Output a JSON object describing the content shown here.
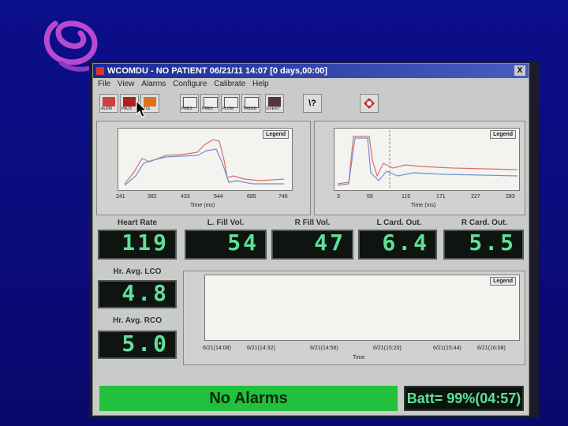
{
  "window": {
    "title": "WCOMDU - NO PATIENT 06/21/11 14:07 [0 days,00:00]",
    "close_label": "X"
  },
  "menu": [
    "File",
    "View",
    "Alarms",
    "Configure",
    "Calibrate",
    "Help"
  ],
  "toolbar": {
    "labels": [
      "ALRM",
      "PAUS",
      "FILE",
      "PRES",
      "PRES",
      "FLOW",
      "TREND",
      "EVENT"
    ],
    "help_label": "\\?"
  },
  "chart_left": {
    "legend": "Legend",
    "xlabel": "Time (ms)",
    "xticks": [
      "241",
      "382",
      "433",
      "544",
      "685",
      "746"
    ]
  },
  "chart_right": {
    "legend": "Legend",
    "xlabel": "Time (ms)",
    "xticks": [
      "3",
      "59",
      "115",
      "171",
      "227",
      "283"
    ]
  },
  "readouts": {
    "heart_rate": {
      "label": "Heart Rate",
      "value": "119"
    },
    "l_fill_vol": {
      "label": "L. Fill Vol.",
      "value": "54"
    },
    "r_fill_vol": {
      "label": "R Fill Vol.",
      "value": "47"
    },
    "l_card_out": {
      "label": "L Card. Out.",
      "value": "6.4"
    },
    "r_card_out": {
      "label": "R Card. Out.",
      "value": "5.5"
    },
    "hr_avg_lco": {
      "label": "Hr. Avg. LCO",
      "value": "4.8"
    },
    "hr_avg_rco": {
      "label": "Hr. Avg. RCO",
      "value": "5.0"
    }
  },
  "trend_chart": {
    "legend": "Legend",
    "xlabel": "Time",
    "xticks": [
      "6/21(14:08)",
      "6/21(14:32)",
      "6/21(14:56)",
      "6/21(15:20)",
      "6/21(15:44)",
      "6/21(16:08)"
    ]
  },
  "status": {
    "alarm_text": "No Alarms",
    "battery_text": "Batt= 99%(04:57)"
  },
  "colors": {
    "background": "#0a0b7a",
    "lcd_text": "#5fe09a",
    "alarm_bar": "#22c03c",
    "title_bar": "#1b2c94"
  }
}
